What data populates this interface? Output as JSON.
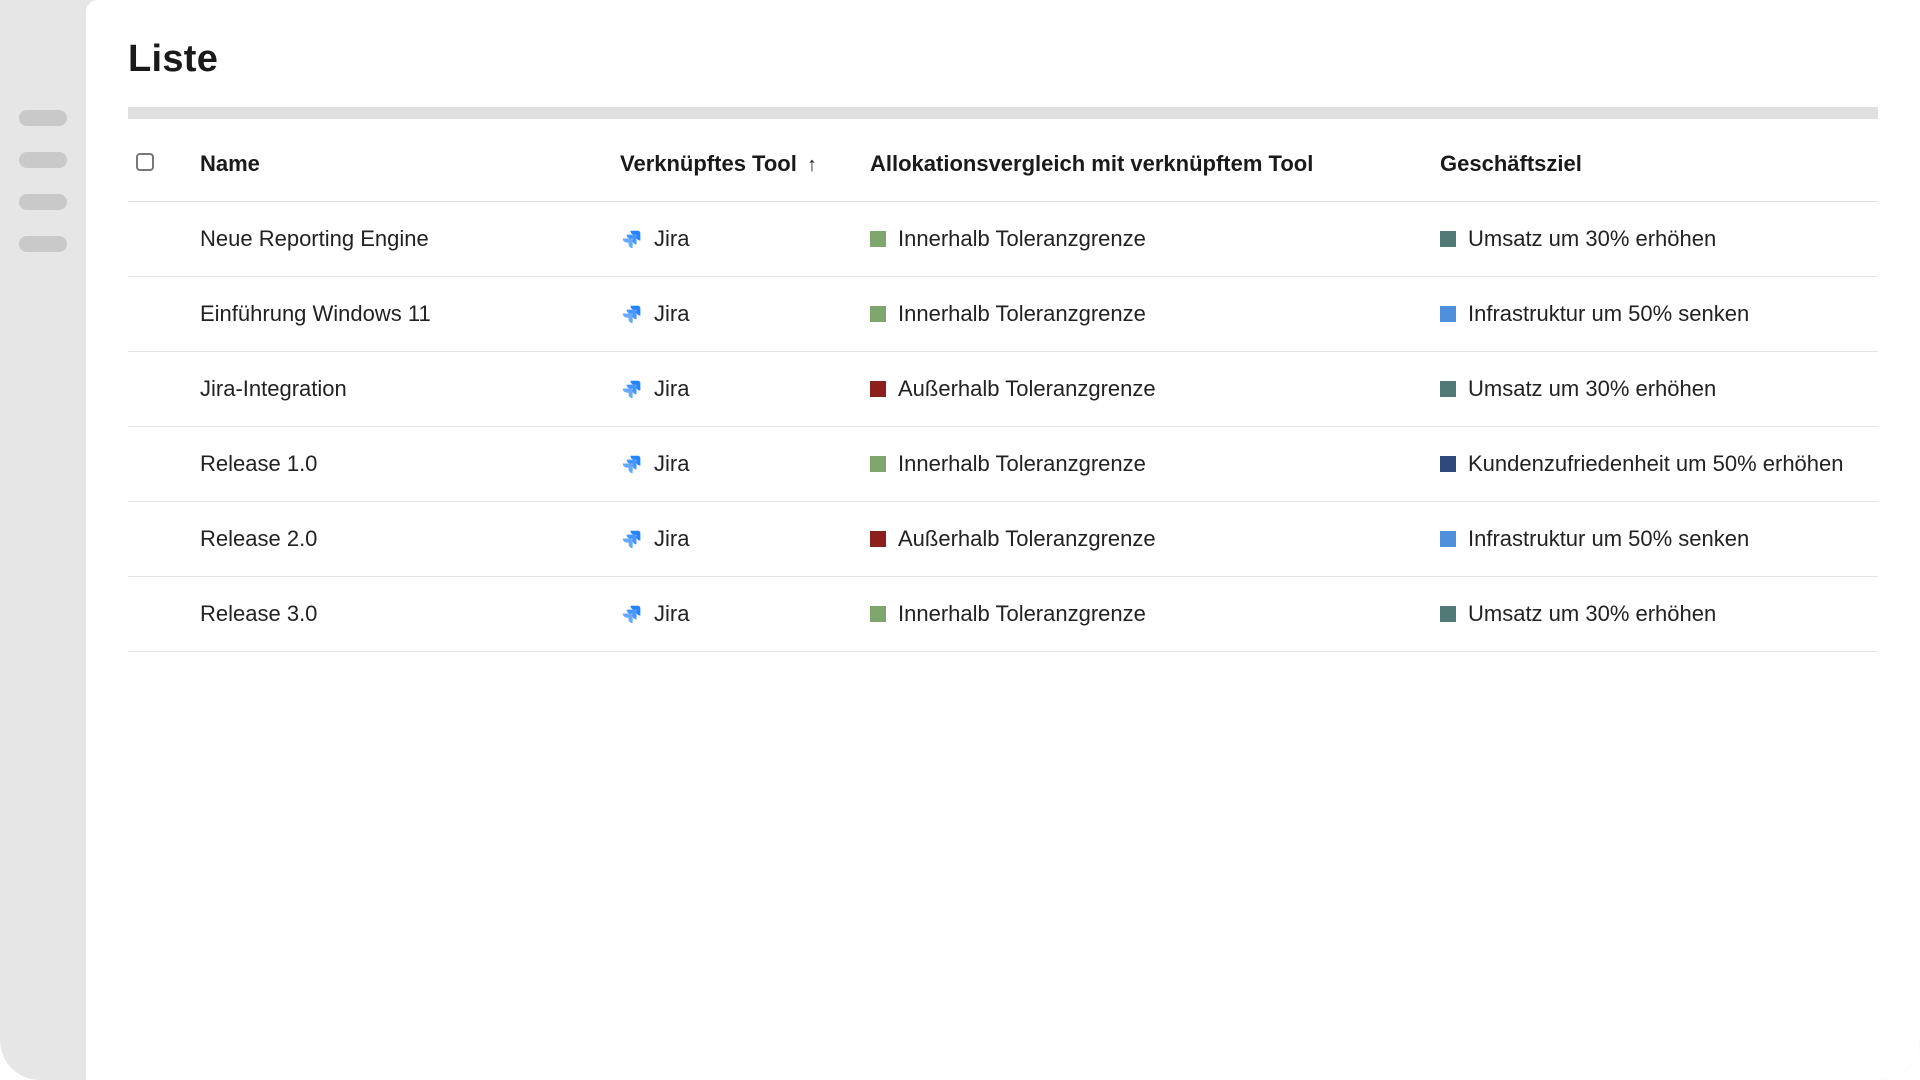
{
  "title": "Liste",
  "columns": {
    "name": "Name",
    "tool": "Verknüpftes Tool",
    "allocation": "Allokationsvergleich mit verknüpftem Tool",
    "goal": "Geschäftsziel"
  },
  "sort": {
    "column": "tool",
    "direction_glyph": "↑"
  },
  "colors": {
    "green": "#7ea66e",
    "darkred": "#8a1f1c",
    "teal": "#517a77",
    "blue": "#4f90dd",
    "navy": "#2e4a7d"
  },
  "tool": {
    "name": "Jira",
    "icon": "jira-icon"
  },
  "allocation_labels": {
    "inside": "Innerhalb Toleranzgrenze",
    "outside": "Außerhalb Toleranzgrenze"
  },
  "goal_labels": {
    "revenue": "Umsatz um 30% erhöhen",
    "infra": "Infrastruktur um 50% senken",
    "customer": "Kundenzufriedenheit um 50% erhöhen"
  },
  "rows": [
    {
      "name": "Neue Reporting Engine",
      "tool": "Jira",
      "allocation": "inside",
      "allocation_color": "green",
      "goal": "revenue",
      "goal_color": "teal"
    },
    {
      "name": "Einführung Windows 11",
      "tool": "Jira",
      "allocation": "inside",
      "allocation_color": "green",
      "goal": "infra",
      "goal_color": "blue"
    },
    {
      "name": "Jira-Integration",
      "tool": "Jira",
      "allocation": "outside",
      "allocation_color": "darkred",
      "goal": "revenue",
      "goal_color": "teal"
    },
    {
      "name": "Release 1.0",
      "tool": "Jira",
      "allocation": "inside",
      "allocation_color": "green",
      "goal": "customer",
      "goal_color": "navy"
    },
    {
      "name": "Release 2.0",
      "tool": "Jira",
      "allocation": "outside",
      "allocation_color": "darkred",
      "goal": "infra",
      "goal_color": "blue"
    },
    {
      "name": "Release 3.0",
      "tool": "Jira",
      "allocation": "inside",
      "allocation_color": "green",
      "goal": "revenue",
      "goal_color": "teal"
    }
  ]
}
